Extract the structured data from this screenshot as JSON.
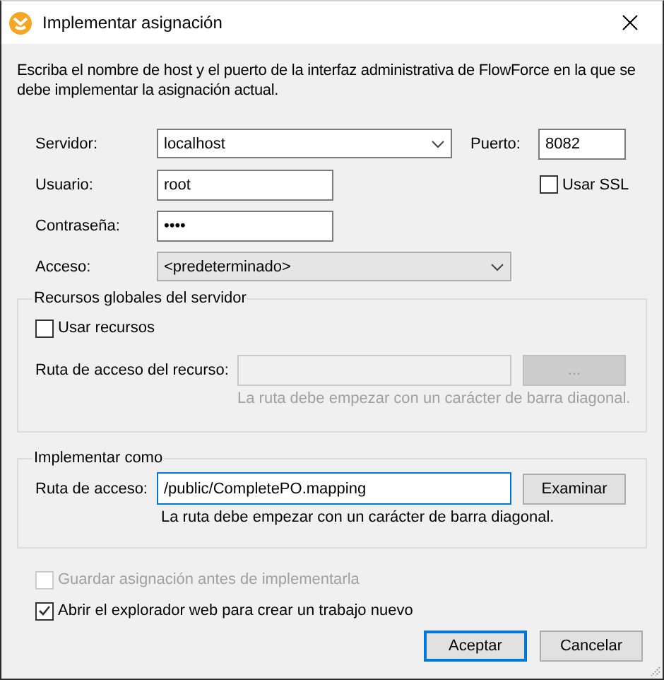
{
  "window": {
    "title": "Implementar asignación"
  },
  "description": "Escriba el nombre de host y el puerto de la interfaz administrativa de FlowForce en la que se debe implementar la asignación actual.",
  "server": {
    "label": "Servidor:",
    "value": "localhost"
  },
  "port": {
    "label": "Puerto:",
    "value": "8082"
  },
  "user": {
    "label": "Usuario:",
    "value": "root"
  },
  "password": {
    "label": "Contraseña:",
    "value": "••••"
  },
  "ssl": {
    "label": "Usar SSL",
    "checked": false
  },
  "access": {
    "label": "Acceso:",
    "value": "<predeterminado>",
    "disabled": true
  },
  "global_resources": {
    "title": "Recursos globales del servidor",
    "use": {
      "label": "Usar recursos",
      "checked": false
    },
    "path_label": "Ruta de acceso del recurso:",
    "browse": "...",
    "hint": "La ruta debe empezar con un carácter de barra diagonal.",
    "disabled": true
  },
  "deploy_as": {
    "title": "Implementar como",
    "path_label": "Ruta de acceso:",
    "path": "/public/CompletePO.mapping",
    "focused": true,
    "browse": "Examinar",
    "hint": "La ruta debe empezar con un carácter de barra diagonal."
  },
  "options": [
    {
      "label": "Guardar asignación antes de implementarla",
      "checked": false,
      "disabled": true
    },
    {
      "label": "Abrir el explorador web para crear un trabajo nuevo",
      "checked": true,
      "disabled": false
    }
  ],
  "buttons": [
    {
      "label": "Aceptar",
      "default": true
    },
    {
      "label": "Cancelar",
      "default": false
    }
  ]
}
